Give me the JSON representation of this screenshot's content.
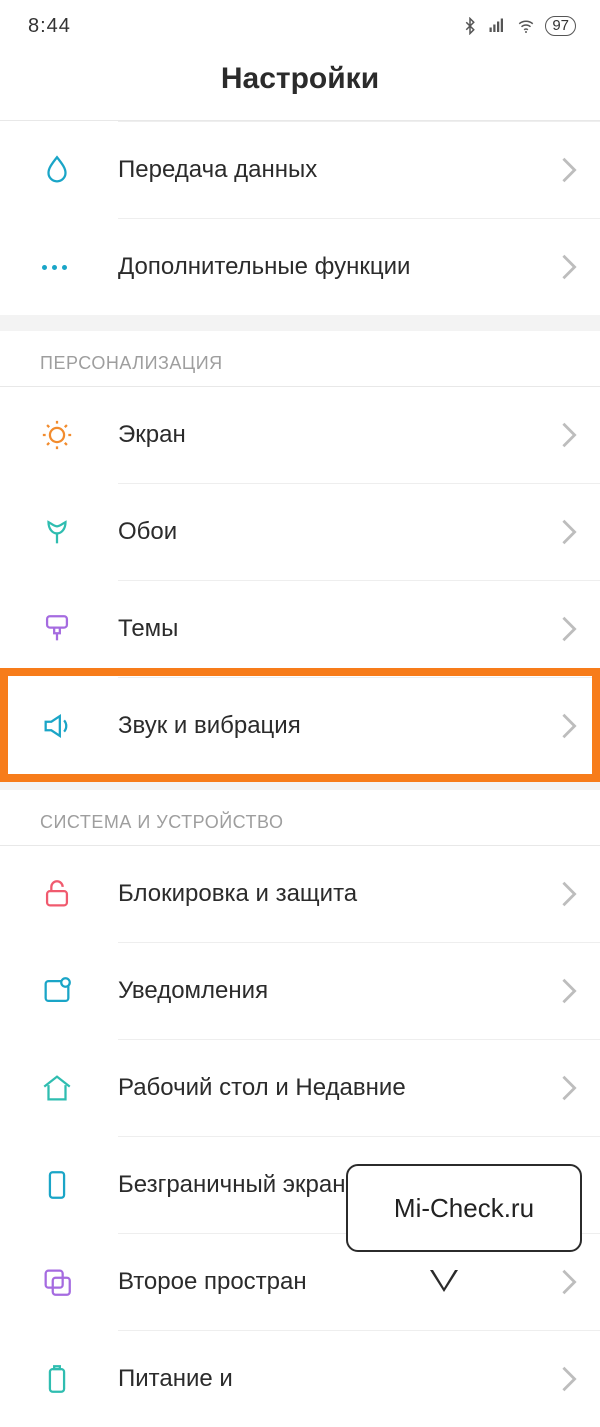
{
  "status": {
    "time": "8:44",
    "battery": "97"
  },
  "title": "Настройки",
  "groups": [
    {
      "header": null,
      "items": [
        {
          "key": "data-usage",
          "label": "Передача данных"
        },
        {
          "key": "more-features",
          "label": "Дополнительные функции"
        }
      ]
    },
    {
      "header": "ПЕРСОНАЛИЗАЦИЯ",
      "items": [
        {
          "key": "display",
          "label": "Экран"
        },
        {
          "key": "wallpaper",
          "label": "Обои"
        },
        {
          "key": "themes",
          "label": "Темы"
        },
        {
          "key": "sound-vibration",
          "label": "Звук и вибрация",
          "highlighted": true
        }
      ]
    },
    {
      "header": "СИСТЕМА И УСТРОЙСТВО",
      "items": [
        {
          "key": "lock-security",
          "label": "Блокировка и защита"
        },
        {
          "key": "notifications",
          "label": "Уведомления"
        },
        {
          "key": "home-recents",
          "label": "Рабочий стол и Недавние"
        },
        {
          "key": "fullscreen",
          "label": "Безграничный экран"
        },
        {
          "key": "second-space",
          "label": "Второе простран"
        },
        {
          "key": "battery-perf",
          "label": "Питание и"
        }
      ]
    }
  ],
  "callout": {
    "text": "Mi-Check.ru"
  },
  "icons": {
    "data-usage": "drop-icon",
    "more-features": "more-icon",
    "display": "sun-icon",
    "wallpaper": "tulip-icon",
    "themes": "brush-icon",
    "sound-vibration": "speaker-icon",
    "lock-security": "lock-icon",
    "notifications": "notification-icon",
    "home-recents": "home-icon",
    "fullscreen": "phone-icon",
    "second-space": "dual-icon",
    "battery-perf": "battery-icon"
  }
}
